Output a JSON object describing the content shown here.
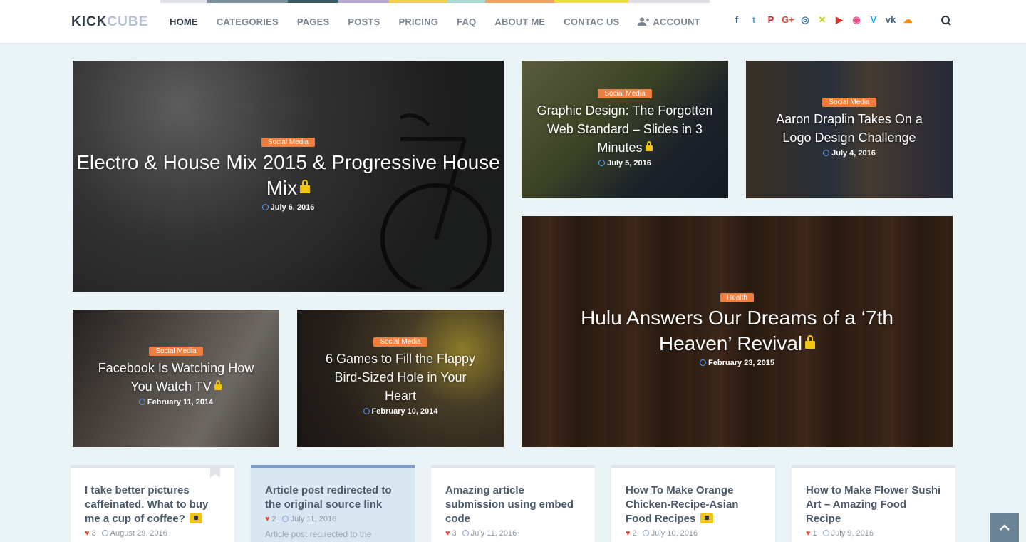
{
  "logo": {
    "part1": "KICK",
    "part2": "CUBE"
  },
  "nav": [
    {
      "label": "HOME",
      "color": "#e0e2ea"
    },
    {
      "label": "CATEGORIES",
      "color": "#7b8f9c"
    },
    {
      "label": "PAGES",
      "color": "#3d5b66"
    },
    {
      "label": "POSTS",
      "color": "#b8a7d6"
    },
    {
      "label": "PRICING",
      "color": "#f4d04a"
    },
    {
      "label": "FAQ",
      "color": "#a8dcd1"
    },
    {
      "label": "ABOUT ME",
      "color": "#f2a35e"
    },
    {
      "label": "CONTAC US",
      "color": "#f0e234"
    },
    {
      "label": "ACCOUNT",
      "color": "#e0dde3"
    }
  ],
  "social": [
    {
      "icon": "facebook-icon",
      "glyph": "f",
      "color": "#3b5998"
    },
    {
      "icon": "twitter-icon",
      "glyph": "t",
      "color": "#55acee"
    },
    {
      "icon": "pinterest-icon",
      "glyph": "P",
      "color": "#cb2027"
    },
    {
      "icon": "google-plus-icon",
      "glyph": "G+",
      "color": "#dd4b39"
    },
    {
      "icon": "instagram-icon",
      "glyph": "◎",
      "color": "#3f729b"
    },
    {
      "icon": "xing-icon",
      "glyph": "✕",
      "color": "#c6d10e"
    },
    {
      "icon": "youtube-icon",
      "glyph": "▶",
      "color": "#e52d27"
    },
    {
      "icon": "dribbble-icon",
      "glyph": "◉",
      "color": "#ea4c89"
    },
    {
      "icon": "vimeo-icon",
      "glyph": "V",
      "color": "#1ab7ea"
    },
    {
      "icon": "vk-icon",
      "glyph": "vk",
      "color": "#45668e"
    },
    {
      "icon": "soundcloud-icon",
      "glyph": "☁",
      "color": "#ff8800"
    }
  ],
  "cards": {
    "c1": {
      "tag": "Social Media",
      "title": "Electro & House Mix 2015 & Progressive House Mix",
      "date": "July 6, 2016"
    },
    "c2": {
      "tag": "Social Media",
      "title": "Graphic Design: The Forgotten Web Standard – Slides in 3 Minutes",
      "date": "July 5, 2016"
    },
    "c3": {
      "tag": "Social Media",
      "title": "Aaron Draplin Takes On a Logo Design Challenge",
      "date": "July 4, 2016"
    },
    "c4": {
      "tag": "Social Media",
      "title": "Facebook Is Watching How You Watch TV",
      "date": "February 11, 2014"
    },
    "c5": {
      "tag": "Social Media",
      "title": "6 Games to Fill the Flappy Bird-Sized Hole in Your Heart",
      "date": "February 10, 2014"
    },
    "c6": {
      "tag": "Health",
      "title": "Hulu Answers Our Dreams of a ‘7th Heaven’ Revival",
      "date": "February 23, 2015"
    }
  },
  "posts": [
    {
      "title": "I take better pictures caffeinated. What to buy me a cup of coffee?",
      "likes": "3",
      "date": "August 29, 2016"
    },
    {
      "title": "Article post redirected to the original source link",
      "likes": "2",
      "date": "July 11, 2016",
      "excerpt": "Article post redirected to the"
    },
    {
      "title": "Amazing article submission using embed code",
      "likes": "3",
      "date": "July 11, 2016"
    },
    {
      "title": "How To Make Orange Chicken-Recipe-Asian Food Recipes",
      "likes": "2",
      "date": "July 10, 2016"
    },
    {
      "title": "How to Make Flower Sushi Art – Amazing Food Recipe",
      "likes": "1",
      "date": "July 9, 2016"
    }
  ]
}
